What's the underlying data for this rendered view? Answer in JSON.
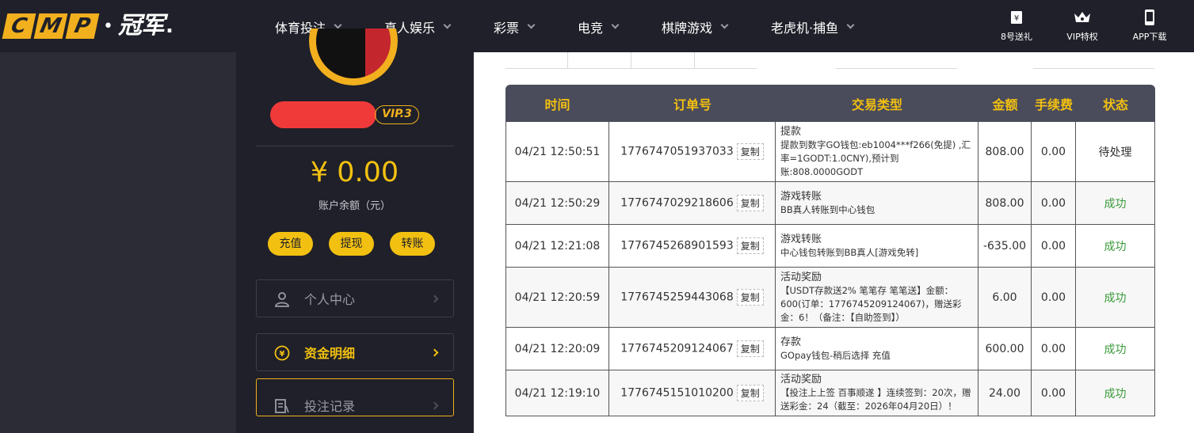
{
  "logo": {
    "letters": [
      "C",
      "M",
      "P"
    ],
    "cn": "冠军",
    "tail": "."
  },
  "nav": [
    {
      "label": "体育投注"
    },
    {
      "label": "真人娱乐"
    },
    {
      "label": "彩票"
    },
    {
      "label": "电竞"
    },
    {
      "label": "棋牌游戏"
    },
    {
      "label": "老虎机·捕鱼"
    }
  ],
  "top_actions": [
    {
      "label": "8号送礼",
      "icon": "ticket-icon"
    },
    {
      "label": "VIP特权",
      "icon": "crown-icon"
    },
    {
      "label": "APP下载",
      "icon": "phone-icon"
    }
  ],
  "profile": {
    "vip": "VIP.3",
    "balance": "¥ 0.00",
    "balance_label": "账户余额（元）",
    "actions": [
      "充值",
      "提现",
      "转账"
    ]
  },
  "menu": [
    {
      "label": "个人中心",
      "icon": "user-icon"
    },
    {
      "label": "资金明细",
      "icon": "yuan-coin-icon"
    },
    {
      "label": "投注记录",
      "icon": "bet-record-icon"
    }
  ],
  "table": {
    "headers": [
      "时间",
      "订单号",
      "交易类型",
      "金额",
      "手续费",
      "状态"
    ],
    "copy_label": "复制",
    "rows": [
      {
        "time": "04/21 12:50:51",
        "order": "1776747051937033",
        "type_title": "提款",
        "type_desc": "提款到数字GO钱包:eb1004***f266(免提) ,汇率=1GODT:1.0CNY),预计到账:808.0000GODT",
        "amount": "808.00",
        "fee": "0.00",
        "status": "待处理",
        "status_kind": "pending"
      },
      {
        "time": "04/21 12:50:29",
        "order": "1776747029218606",
        "type_title": "游戏转账",
        "type_desc": "BB真人转账到中心钱包",
        "amount": "808.00",
        "fee": "0.00",
        "status": "成功",
        "status_kind": "ok"
      },
      {
        "time": "04/21 12:21:08",
        "order": "1776745268901593",
        "type_title": "游戏转账",
        "type_desc": "中心钱包转账到BB真人[游戏免转]",
        "amount": "-635.00",
        "fee": "0.00",
        "status": "成功",
        "status_kind": "ok"
      },
      {
        "time": "04/21 12:20:59",
        "order": "1776745259443068",
        "type_title": "活动奖励",
        "type_desc": "【USDT存款送2% 笔笔存 笔笔送】金额：600(订单：1776745209124067)，赠送彩金：6！（备注：【自助签到】）",
        "amount": "6.00",
        "fee": "0.00",
        "status": "成功",
        "status_kind": "ok"
      },
      {
        "time": "04/21 12:20:09",
        "order": "1776745209124067",
        "type_title": "存款",
        "type_desc": "GOpay钱包-稍后选择 充值",
        "amount": "600.00",
        "fee": "0.00",
        "status": "成功",
        "status_kind": "ok"
      },
      {
        "time": "04/21 12:19:10",
        "order": "1776745151010200",
        "type_title": "活动奖励",
        "type_desc": "【投注上上签 百事顺遂 】连续签到：20次，赠送彩金：24（截至：2026年04月20日）！",
        "amount": "24.00",
        "fee": "0.00",
        "status": "成功",
        "status_kind": "ok"
      }
    ]
  },
  "colors": {
    "accent": "#f2c011",
    "brand": "#f2b01e",
    "dark": "#1f2029",
    "success": "#3a9a3a",
    "header": "#4a4b5b"
  }
}
